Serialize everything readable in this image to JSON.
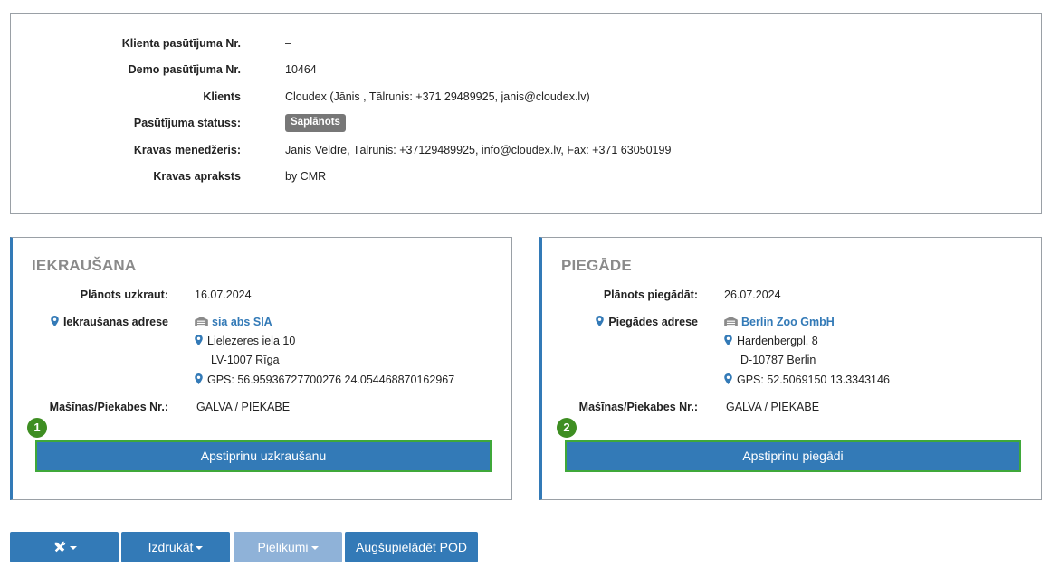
{
  "order_info": {
    "rows": [
      {
        "label": "Klienta pasūtījuma Nr.",
        "value": "–"
      },
      {
        "label": "Demo pasūtījuma Nr.",
        "value": "10464"
      },
      {
        "label": "Klients",
        "value": "Cloudex (Jānis , Tālrunis: +371 29489925, janis@cloudex.lv)"
      },
      {
        "label": "Pasūtījuma statuss:",
        "value": "Saplānots"
      },
      {
        "label": "Kravas menedžeris:",
        "value": "Jānis Veldre, Tālrunis: +37129489925, info@cloudex.lv, Fax: +371 63050199"
      },
      {
        "label": "Kravas apraksts",
        "value": "by CMR"
      }
    ]
  },
  "loading": {
    "title": "IEKRAUŠANA",
    "planned_label": "Plānots uzkraut:",
    "planned_value": "16.07.2024",
    "address_label": "Iekraušanas adrese",
    "company": "sia abs SIA",
    "street": "Lielezeres iela 10",
    "city": "LV-1007 Rīga",
    "gps": "GPS: 56.95936727700276 24.054468870162967",
    "vehicle_label": "Mašīnas/Piekabes Nr.:",
    "vehicle_value": "GALVA / PIEKABE",
    "step": "1",
    "confirm_label": "Apstiprinu uzkraušanu"
  },
  "delivery": {
    "title": "PIEGĀDE",
    "planned_label": "Plānots piegādāt:",
    "planned_value": "26.07.2024",
    "address_label": "Piegādes adrese",
    "company": "Berlin Zoo GmbH",
    "street": "Hardenbergpl. 8",
    "city": "D-10787 Berlin",
    "gps": "GPS: 52.5069150 13.3343146",
    "vehicle_label": "Mašīnas/Piekabes Nr.:",
    "vehicle_value": "GALVA / PIEKABE",
    "step": "2",
    "confirm_label": "Apstiprinu piegādi"
  },
  "toolbar": {
    "tools_icon": "tools-icon",
    "print_label": "Izdrukāt",
    "attachments_label": "Pielikumi",
    "upload_pod_label": "Augšupielādēt POD"
  },
  "colors": {
    "primary": "#337ab7",
    "disabled": "#8fb2d8",
    "highlight_border": "#3fa83a",
    "step_badge": "#3e8e22",
    "status_badge": "#777777",
    "card_title": "#8a8a8a"
  }
}
